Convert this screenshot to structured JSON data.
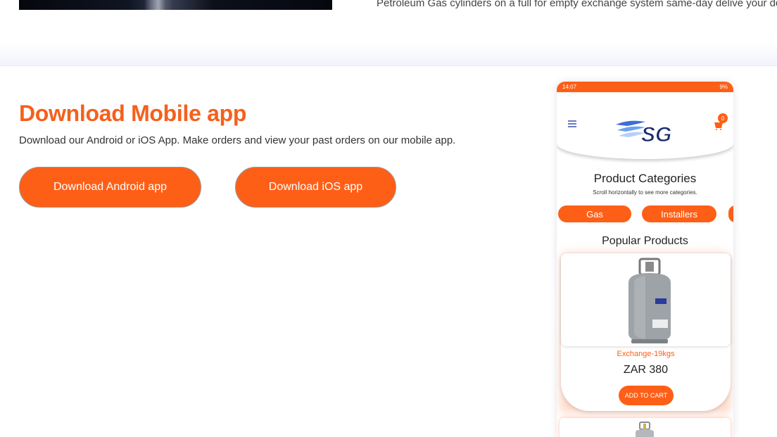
{
  "top": {
    "description": "Petroleum Gas cylinders on a full for empty exchange system same-day delive your door."
  },
  "download": {
    "title": "Download Mobile app",
    "description": "Download our Android or iOS App. Make orders and view your past orders on our mobile app.",
    "android_button": "Download Android app",
    "ios_button": "Download iOS app"
  },
  "phone": {
    "status_time": "14:07",
    "status_right": "9%",
    "cart_count": "0",
    "categories_title": "Product Categories",
    "categories_subtitle": "Scroll horizontally to see more categories.",
    "categories": [
      "Gas",
      "Installers"
    ],
    "popular_title": "Popular Products",
    "product": {
      "name": "Exchange-19kgs",
      "price": "ZAR 380",
      "add_to_cart": "ADD TO CART"
    }
  },
  "colors": {
    "accent": "#fe5f17",
    "title": "#f5601c",
    "icon_blue": "#6a7bbf"
  }
}
